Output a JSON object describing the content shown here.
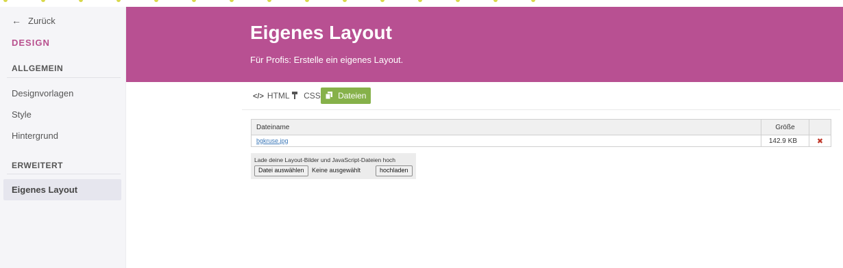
{
  "sidebar": {
    "back_label": "Zurück",
    "section_design": "DESIGN",
    "section_general": "ALLGEMEIN",
    "items_general": [
      "Designvorlagen",
      "Style",
      "Hintergrund"
    ],
    "section_advanced": "ERWEITERT",
    "active_item": "Eigenes Layout"
  },
  "header": {
    "title": "Eigenes Layout",
    "subtitle": "Für Profis: Erstelle ein eigenes Layout."
  },
  "tabs": [
    {
      "label": "HTML",
      "icon": "code-icon"
    },
    {
      "label": "CSS",
      "icon": "paint-roller-icon"
    },
    {
      "label": "Dateien",
      "icon": "files-icon",
      "active": true
    }
  ],
  "files": {
    "headers": {
      "name": "Dateiname",
      "size": "Größe"
    },
    "rows": [
      {
        "name": "bgkruse.jpg",
        "size": "142.9 KB",
        "action_icon": "delete-icon"
      }
    ]
  },
  "upload": {
    "hint": "Lade deine Layout-Bilder und JavaScript-Dateien hoch",
    "choose_label": "Datei auswählen",
    "no_file_label": "Keine ausgewählt",
    "upload_label": "hochladen"
  },
  "colors": {
    "brand": "#b85092",
    "tab_active": "#86b14a",
    "delete": "#c0392b",
    "link": "#3a77b8"
  }
}
